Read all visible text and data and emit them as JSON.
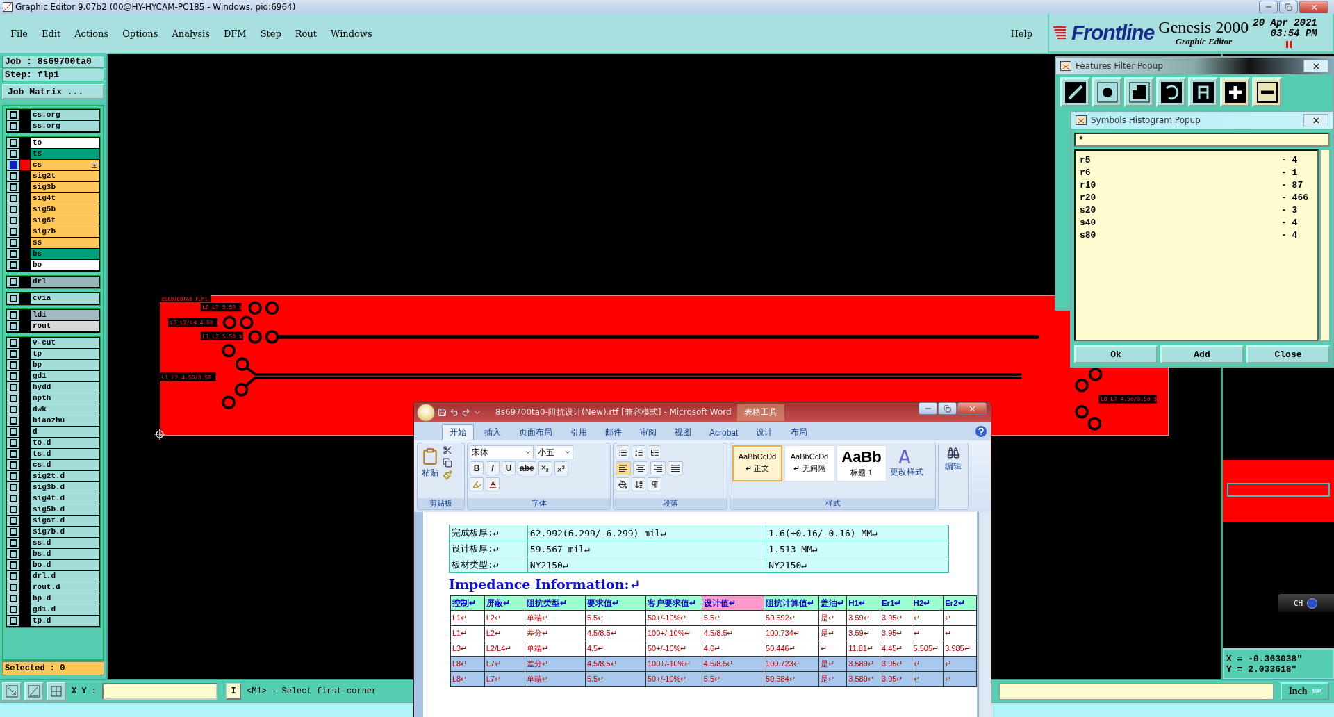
{
  "window": {
    "title": "Graphic Editor 9.07b2 (00@HY-HYCAM-PC185 - Windows, pid:6964)"
  },
  "menu": [
    "File",
    "Edit",
    "Actions",
    "Options",
    "Analysis",
    "DFM",
    "Step",
    "Rout",
    "Windows"
  ],
  "help_menu": "Help",
  "brand": {
    "logo": "Frontline",
    "product": "Genesis 2000",
    "subtitle": "Graphic Editor",
    "date": "20 Apr 2021",
    "time": "03:54 PM"
  },
  "job_panel": {
    "job": "Job : 8s69700ta0",
    "step": "Step: flp1",
    "matrix_button": "Job Matrix ...",
    "selected_count": "Selected : 0",
    "layer_groups": [
      {
        "items": [
          {
            "name": "cs.org",
            "color": "#a4dcdc",
            "selected": false
          },
          {
            "name": "ss.org",
            "color": "#a4dcdc",
            "selected": false
          }
        ]
      },
      {
        "items": [
          {
            "name": "to",
            "color": "#ffffff",
            "selected": false
          },
          {
            "name": "ts",
            "color": "#009e7a",
            "selected": false
          },
          {
            "name": "cs",
            "color": "#ffc65a",
            "selected": true
          },
          {
            "name": "sig2t",
            "color": "#ffc65a",
            "selected": false
          },
          {
            "name": "sig3b",
            "color": "#ffc65a",
            "selected": false
          },
          {
            "name": "sig4t",
            "color": "#ffc65a",
            "selected": false
          },
          {
            "name": "sig5b",
            "color": "#ffc65a",
            "selected": false
          },
          {
            "name": "sig6t",
            "color": "#ffc65a",
            "selected": false
          },
          {
            "name": "sig7b",
            "color": "#ffc65a",
            "selected": false
          },
          {
            "name": "ss",
            "color": "#ffc65a",
            "selected": false
          },
          {
            "name": "bs",
            "color": "#009e7a",
            "selected": false
          },
          {
            "name": "bo",
            "color": "#ffffff",
            "selected": false
          }
        ]
      },
      {
        "items": [
          {
            "name": "drl",
            "color": "#9cb4bc",
            "selected": false
          }
        ]
      },
      {
        "items": [
          {
            "name": "cvia",
            "color": "#a4dcdc",
            "selected": false
          }
        ]
      },
      {
        "items": [
          {
            "name": "ldi",
            "color": "#a4b8c4",
            "selected": false
          },
          {
            "name": "rout",
            "color": "#d8d8d8",
            "selected": false
          }
        ]
      },
      {
        "items": [
          {
            "name": "v-cut",
            "color": "#a4dcdc",
            "selected": false
          },
          {
            "name": "tp",
            "color": "#a4dcdc",
            "selected": false
          },
          {
            "name": "bp",
            "color": "#a4dcdc",
            "selected": false
          },
          {
            "name": "gd1",
            "color": "#a4dcdc",
            "selected": false
          },
          {
            "name": "hydd",
            "color": "#a4dcdc",
            "selected": false
          },
          {
            "name": "npth",
            "color": "#a4dcdc",
            "selected": false
          },
          {
            "name": "dwk",
            "color": "#a4dcdc",
            "selected": false
          },
          {
            "name": "biaozhu",
            "color": "#a4dcdc",
            "selected": false
          },
          {
            "name": "d",
            "color": "#a4dcdc",
            "selected": false
          },
          {
            "name": "to.d",
            "color": "#a4dcdc",
            "selected": false
          },
          {
            "name": "ts.d",
            "color": "#a4dcdc",
            "selected": false
          },
          {
            "name": "cs.d",
            "color": "#a4dcdc",
            "selected": false
          },
          {
            "name": "sig2t.d",
            "color": "#a4dcdc",
            "selected": false
          },
          {
            "name": "sig3b.d",
            "color": "#a4dcdc",
            "selected": false
          },
          {
            "name": "sig4t.d",
            "color": "#a4dcdc",
            "selected": false
          },
          {
            "name": "sig5b.d",
            "color": "#a4dcdc",
            "selected": false
          },
          {
            "name": "sig6t.d",
            "color": "#a4dcdc",
            "selected": false
          },
          {
            "name": "sig7b.d",
            "color": "#a4dcdc",
            "selected": false
          },
          {
            "name": "ss.d",
            "color": "#a4dcdc",
            "selected": false
          },
          {
            "name": "bs.d",
            "color": "#a4dcdc",
            "selected": false
          },
          {
            "name": "bo.d",
            "color": "#a4dcdc",
            "selected": false
          },
          {
            "name": "drl.d",
            "color": "#a4dcdc",
            "selected": false
          },
          {
            "name": "rout.d",
            "color": "#a4dcdc",
            "selected": false
          },
          {
            "name": "bp.d",
            "color": "#a4dcdc",
            "selected": false
          },
          {
            "name": "gd1.d",
            "color": "#a4dcdc",
            "selected": false
          },
          {
            "name": "tp.d",
            "color": "#a4dcdc",
            "selected": false
          }
        ]
      }
    ]
  },
  "canvas": {
    "labels": [
      "8S69700TA0 FLP1",
      "L8_L7 5.50 $",
      "L3_L2/L4 4.60 $",
      "L1_L2 5.50 $",
      "L1_L2 4.50/8.50 $",
      "L8_L7 4.50/8.50 $"
    ]
  },
  "coordinates": {
    "x": "X = -0.363038\"",
    "y": "Y = 2.033618\""
  },
  "ime_bar": {
    "label": "CH"
  },
  "command_bar": {
    "xy_label": "X Y :",
    "toggle": "I",
    "prompt": "<M1> - Select first corner",
    "units": "Inch"
  },
  "features_filter": {
    "title": "Features Filter Popup"
  },
  "histogram": {
    "title": "Symbols Histogram Popup",
    "filter": "*",
    "rows": [
      {
        "symbol": "r5",
        "count": "- 4"
      },
      {
        "symbol": "r6",
        "count": "- 1"
      },
      {
        "symbol": "r10",
        "count": "- 87"
      },
      {
        "symbol": "r20",
        "count": "- 466"
      },
      {
        "symbol": "s20",
        "count": "- 3"
      },
      {
        "symbol": "s40",
        "count": "- 4"
      },
      {
        "symbol": "s80",
        "count": "- 4"
      }
    ],
    "buttons": [
      "Ok",
      "Add",
      "Close"
    ]
  },
  "word": {
    "title": "8s69700ta0-阻抗设计(New).rtf [兼容模式] - Microsoft Word",
    "context_tab": "表格工具",
    "tabs": [
      {
        "label": "开始",
        "selected": true
      },
      {
        "label": "插入",
        "selected": false
      },
      {
        "label": "页面布局",
        "selected": false
      },
      {
        "label": "引用",
        "selected": false
      },
      {
        "label": "邮件",
        "selected": false
      },
      {
        "label": "审阅",
        "selected": false
      },
      {
        "label": "视图",
        "selected": false
      },
      {
        "label": "Acrobat",
        "selected": false
      },
      {
        "label": "设计",
        "selected": false
      },
      {
        "label": "布局",
        "selected": false
      }
    ],
    "ribbon": {
      "paste": "粘贴",
      "clipboard_group": "剪贴板",
      "font_name": "宋体",
      "font_size": "小五",
      "font_buttons": [
        "B",
        "I",
        "U",
        "abe"
      ],
      "font_group": "字体",
      "paragraph_group": "段落",
      "styles": [
        {
          "sample": "AaBbCcDd",
          "name": "↵ 正文",
          "selected": true
        },
        {
          "sample": "AaBbCcDd",
          "name": "↵ 无间隔",
          "selected": false
        },
        {
          "sample": "AaBb",
          "name": "标题 1",
          "selected": false
        }
      ],
      "change_styles": "更改样式",
      "styles_group": "样式",
      "editing": "编辑"
    },
    "info_table": [
      [
        "完成板厚:↵",
        "62.992(6.299/-6.299) mil↵",
        "1.6(+0.16/-0.16) MM↵"
      ],
      [
        "设计板厚:↵",
        "59.567 mil↵",
        "1.513 MM↵"
      ],
      [
        "板材类型:↵",
        "NY2150↵",
        "NY2150↵"
      ]
    ],
    "heading": "Impedance Information:↵",
    "impedance_table": {
      "columns": [
        {
          "label": "控制↵",
          "highlight": false
        },
        {
          "label": "屏蔽↵",
          "highlight": false
        },
        {
          "label": "阻抗类型↵",
          "highlight": false
        },
        {
          "label": "要求值↵",
          "highlight": false
        },
        {
          "label": "客户要求值↵",
          "highlight": false
        },
        {
          "label": "设计值↵",
          "highlight": true
        },
        {
          "label": "阻抗计算值↵",
          "highlight": false
        },
        {
          "label": "盖油↵",
          "highlight": false
        },
        {
          "label": "H1↵",
          "highlight": false
        },
        {
          "label": "Er1↵",
          "highlight": false
        },
        {
          "label": "H2↵",
          "highlight": false
        },
        {
          "label": "Er2↵",
          "highlight": false
        }
      ],
      "rows": [
        {
          "selected": false,
          "cells": [
            "L1↵",
            "L2↵",
            "单端↵",
            "5.5↵",
            "50+/-10%↵",
            "5.5↵",
            "50.592↵",
            "是↵",
            "3.59↵",
            "3.95↵",
            "↵",
            "↵"
          ]
        },
        {
          "selected": false,
          "cells": [
            "L1↵",
            "L2↵",
            "差分↵",
            "4.5/8.5↵",
            "100+/-10%↵",
            "4.5/8.5↵",
            "100.734↵",
            "是↵",
            "3.59↵",
            "3.95↵",
            "↵",
            "↵"
          ]
        },
        {
          "selected": false,
          "cells": [
            "L3↵",
            "L2/L4↵",
            "单端↵",
            "4.5↵",
            "50+/-10%↵",
            "4.6↵",
            "50.446↵",
            "↵",
            "11.81↵",
            "4.45↵",
            "5.505↵",
            "3.985↵"
          ]
        },
        {
          "selected": true,
          "cells": [
            "L8↵",
            "L7↵",
            "差分↵",
            "4.5/8.5↵",
            "100+/-10%↵",
            "4.5/8.5↵",
            "100.723↵",
            "是↵",
            "3.589↵",
            "3.95↵",
            "↵",
            "↵"
          ]
        },
        {
          "selected": true,
          "cells": [
            "L8↵",
            "L7↵",
            "单端↵",
            "5.5↵",
            "50+/-10%↵",
            "5.5↵",
            "50.584↵",
            "是↵",
            "3.589↵",
            "3.95↵",
            "↵",
            "↵"
          ]
        }
      ]
    }
  }
}
